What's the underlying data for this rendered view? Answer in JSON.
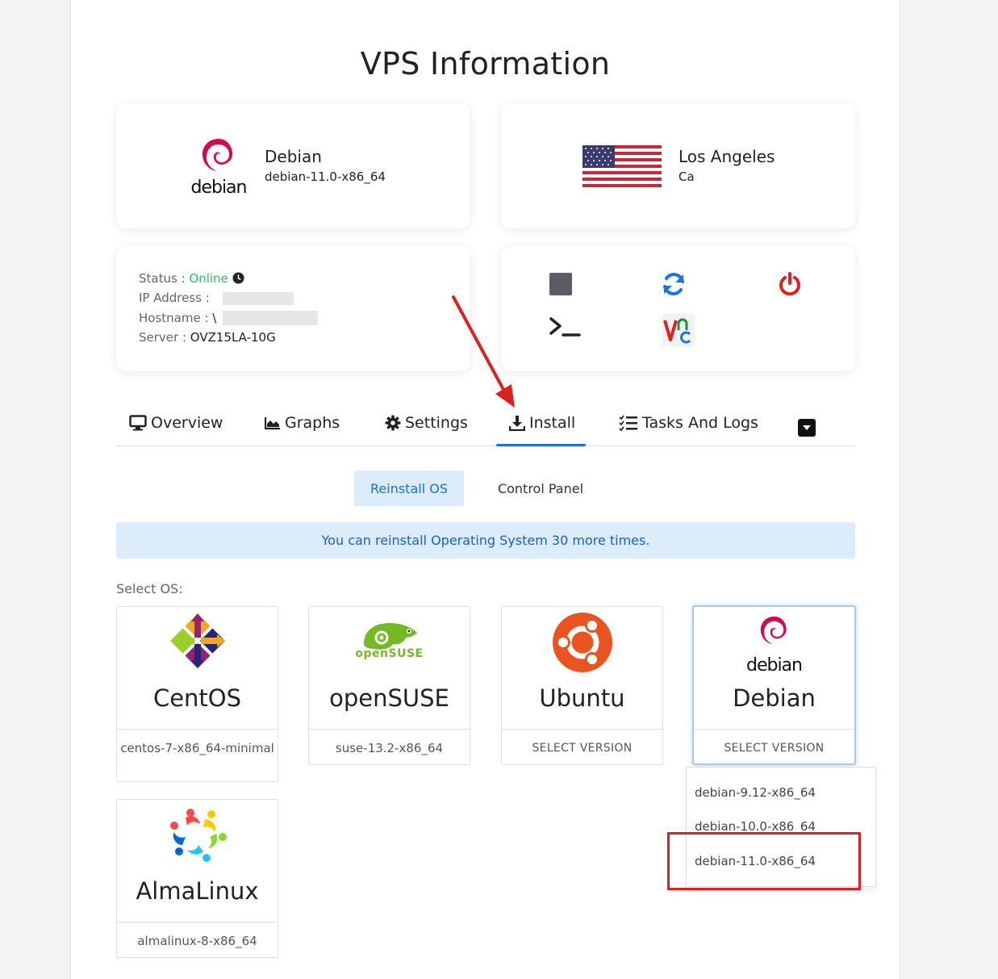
{
  "page": {
    "title": "VPS Information"
  },
  "os_summary": {
    "logo_text": "debian",
    "name": "Debian",
    "version": "debian-11.0-x86_64"
  },
  "location": {
    "city": "Los Angeles",
    "region": "Ca",
    "flag": "us-flag-icon"
  },
  "server_info": {
    "status_label": "Status :",
    "status_value": "Online",
    "ip_label": "IP Address :",
    "hostname_label": "Hostname :",
    "hostname_prefix": "\\",
    "server_label": "Server :",
    "server_value": "OVZ15LA-10G"
  },
  "controls": [
    {
      "icon": "stop-icon",
      "color": "#5c5c66"
    },
    {
      "icon": "restart-icon",
      "color": "#1a73e8"
    },
    {
      "icon": "power-icon",
      "color": "#e02020"
    },
    {
      "icon": "terminal-icon",
      "color": "#222222"
    },
    {
      "icon": "vnc-icon",
      "color": "#e02020"
    }
  ],
  "tabs": {
    "overview": "Overview",
    "graphs": "Graphs",
    "settings": "Settings",
    "install": "Install",
    "tasks": "Tasks And Logs",
    "active": "Install"
  },
  "subtabs": {
    "reinstall": "Reinstall OS",
    "control_panel": "Control Panel"
  },
  "alert": {
    "text": "You can reinstall Operating System 30 more times."
  },
  "select_os": {
    "label": "Select OS:",
    "options": [
      {
        "name": "CentOS",
        "version": "centos-7-x86_64-minimal"
      },
      {
        "name": "openSUSE",
        "logo_text": "openSUSE",
        "version": "suse-13.2-x86_64"
      },
      {
        "name": "Ubuntu",
        "version": "SELECT VERSION"
      },
      {
        "name": "Debian",
        "logo_text": "debian",
        "version": "SELECT VERSION"
      },
      {
        "name": "AlmaLinux",
        "version": "almalinux-8-x86_64"
      }
    ],
    "selected": "Debian"
  },
  "debian_versions": [
    "debian-9.12-x86_64",
    "debian-10.0-x86_64",
    "debian-11.0-x86_64"
  ],
  "colors": {
    "accent": "#1a6fd8",
    "online": "#22c55e",
    "annotation": "#e02020"
  }
}
